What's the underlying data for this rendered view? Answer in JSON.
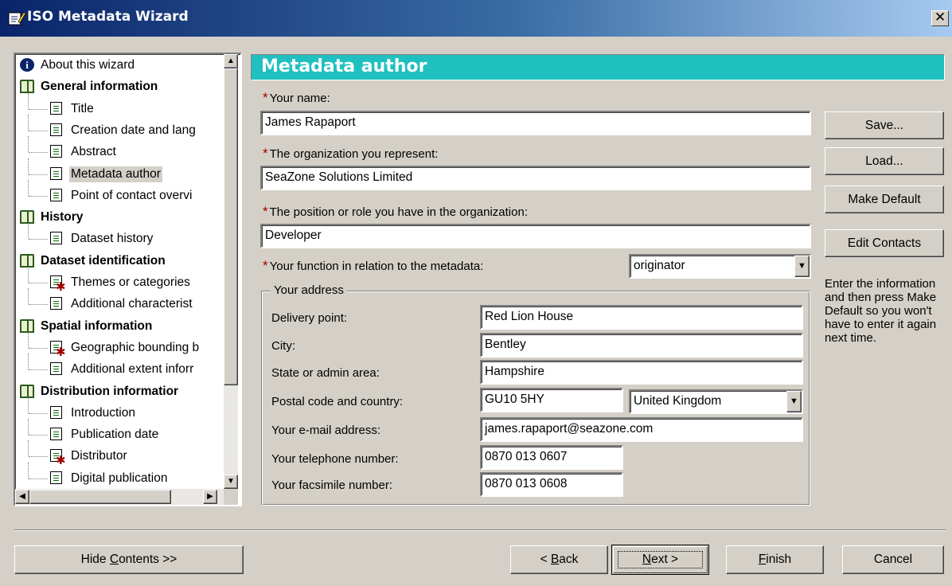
{
  "window": {
    "title": "ISO Metadata Wizard",
    "close_glyph": "✕"
  },
  "tree": {
    "items": [
      {
        "label": "About this wizard",
        "kind": "info",
        "level": 0
      },
      {
        "label": "General information",
        "kind": "book",
        "level": 0
      },
      {
        "label": "Title",
        "kind": "doc",
        "level": 1
      },
      {
        "label": "Creation date and lang",
        "kind": "doc",
        "level": 1
      },
      {
        "label": "Abstract",
        "kind": "doc",
        "level": 1
      },
      {
        "label": "Metadata author",
        "kind": "doc",
        "level": 1,
        "selected": true
      },
      {
        "label": "Point of contact overvi",
        "kind": "doc",
        "level": 1
      },
      {
        "label": "History",
        "kind": "book",
        "level": 0
      },
      {
        "label": "Dataset history",
        "kind": "doc",
        "level": 1
      },
      {
        "label": "Dataset identification",
        "kind": "book",
        "level": 0
      },
      {
        "label": "Themes or categories",
        "kind": "doc-required",
        "level": 1
      },
      {
        "label": "Additional characterist",
        "kind": "doc",
        "level": 1
      },
      {
        "label": "Spatial information",
        "kind": "book",
        "level": 0
      },
      {
        "label": "Geographic bounding b",
        "kind": "doc-required",
        "level": 1
      },
      {
        "label": "Additional extent inforr",
        "kind": "doc",
        "level": 1
      },
      {
        "label": "Distribution informatior",
        "kind": "book",
        "level": 0
      },
      {
        "label": "Introduction",
        "kind": "doc",
        "level": 1
      },
      {
        "label": "Publication date",
        "kind": "doc",
        "level": 1
      },
      {
        "label": "Distributor",
        "kind": "doc-required",
        "level": 1
      },
      {
        "label": "Digital publication",
        "kind": "doc",
        "level": 1
      }
    ]
  },
  "page": {
    "title": "Metadata author",
    "required_mark": "*",
    "name": {
      "label": "Your name:",
      "value": "James Rapaport"
    },
    "organization": {
      "label": "The organization you represent:",
      "value": "SeaZone Solutions Limited"
    },
    "position": {
      "label": "The position or role you have in the organization:",
      "value": "Developer"
    },
    "function": {
      "label": "Your function in relation to the metadata:",
      "value": "originator"
    },
    "address": {
      "legend": "Your address",
      "delivery_point": {
        "label": "Delivery point:",
        "value": "Red Lion House"
      },
      "city": {
        "label": "City:",
        "value": "Bentley"
      },
      "state": {
        "label": "State or admin area:",
        "value": "Hampshire"
      },
      "postal": {
        "label": "Postal code and country:",
        "value": "GU10 5HY",
        "country": "United Kingdom"
      },
      "email": {
        "label": "Your e-mail address:",
        "value": "james.rapaport@seazone.com"
      },
      "telephone": {
        "label": "Your telephone number:",
        "value": "0870 013 0607"
      },
      "fax": {
        "label": "Your facsimile number:",
        "value": "0870 013 0608"
      }
    }
  },
  "side_buttons": {
    "save": "Save...",
    "load": "Load...",
    "make_default": "Make Default",
    "edit_contacts": "Edit Contacts"
  },
  "help_text": "Enter the information and then press Make Default so you won't have to enter it again next time.",
  "footer": {
    "hide_contents_pre": "Hide ",
    "hide_contents_key": "C",
    "hide_contents_post": "ontents >>",
    "back_pre": "< ",
    "back_key": "B",
    "back_post": "ack",
    "next_key": "N",
    "next_post": "ext >",
    "finish_key": "F",
    "finish_post": "inish",
    "cancel": "Cancel"
  }
}
